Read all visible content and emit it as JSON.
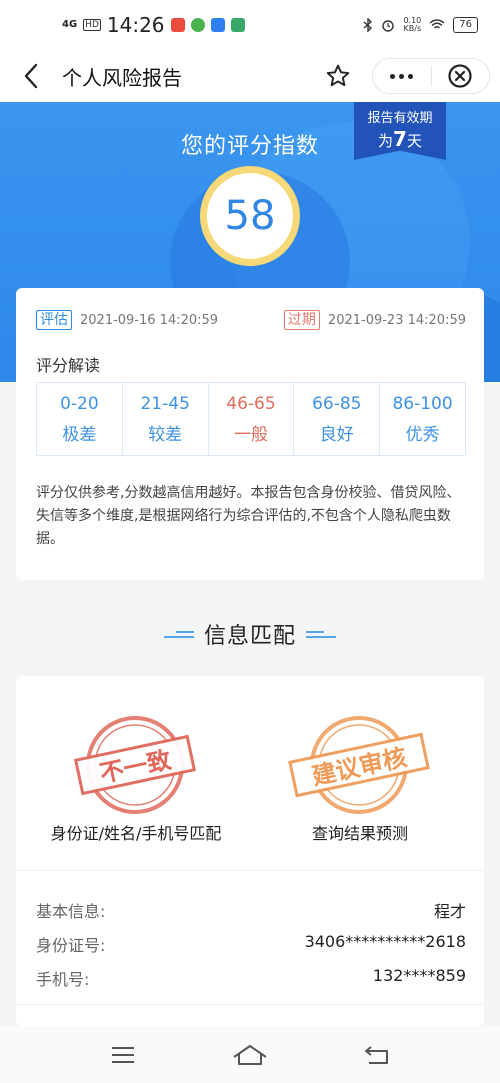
{
  "status_bar": {
    "signal": "4G",
    "hd": "HD",
    "time": "14:26",
    "net_speed": "0.10",
    "net_unit": "KB/s",
    "battery": "76",
    "icons": [
      "bluetooth-icon",
      "alarm-icon",
      "wifi-icon"
    ]
  },
  "nav": {
    "title": "个人风险报告"
  },
  "hero": {
    "title": "您的评分指数",
    "score": "58",
    "validity_line1": "报告有效期",
    "validity_prefix": "为",
    "validity_days": "7",
    "validity_suffix": "天"
  },
  "report": {
    "eval_tag": "评估",
    "eval_time": "2021-09-16 14:20:59",
    "expire_tag": "过期",
    "expire_time": "2021-09-23 14:20:59",
    "interp_title": "评分解读",
    "ranges": [
      {
        "range": "0-20",
        "label": "极差"
      },
      {
        "range": "21-45",
        "label": "较差"
      },
      {
        "range": "46-65",
        "label": "一般"
      },
      {
        "range": "66-85",
        "label": "良好"
      },
      {
        "range": "86-100",
        "label": "优秀"
      }
    ],
    "note": "评分仅供参考,分数越高信用越好。本报告包含身份校验、借贷风险、失信等多个维度,是根据网络行为综合评估的,不包含个人隐私爬虫数据。"
  },
  "section": {
    "title": "信息匹配"
  },
  "match": {
    "stamp_left": "不一致",
    "label_left": "身份证/姓名/手机号匹配",
    "stamp_right": "建议审核",
    "label_right": "查询结果预测",
    "rows": [
      {
        "key": "基本信息:",
        "value": "程才"
      },
      {
        "key": "身份证号:",
        "value": "3406**********2618"
      },
      {
        "key": "手机号:",
        "value": "132****859"
      }
    ]
  },
  "colors": {
    "primary": "#2d88ea",
    "score_ring": "#f6d878",
    "badge": "#2253b9",
    "warn": "#e06f5d",
    "stamp_red": "#e0675a",
    "stamp_orange": "#ef9a57"
  }
}
